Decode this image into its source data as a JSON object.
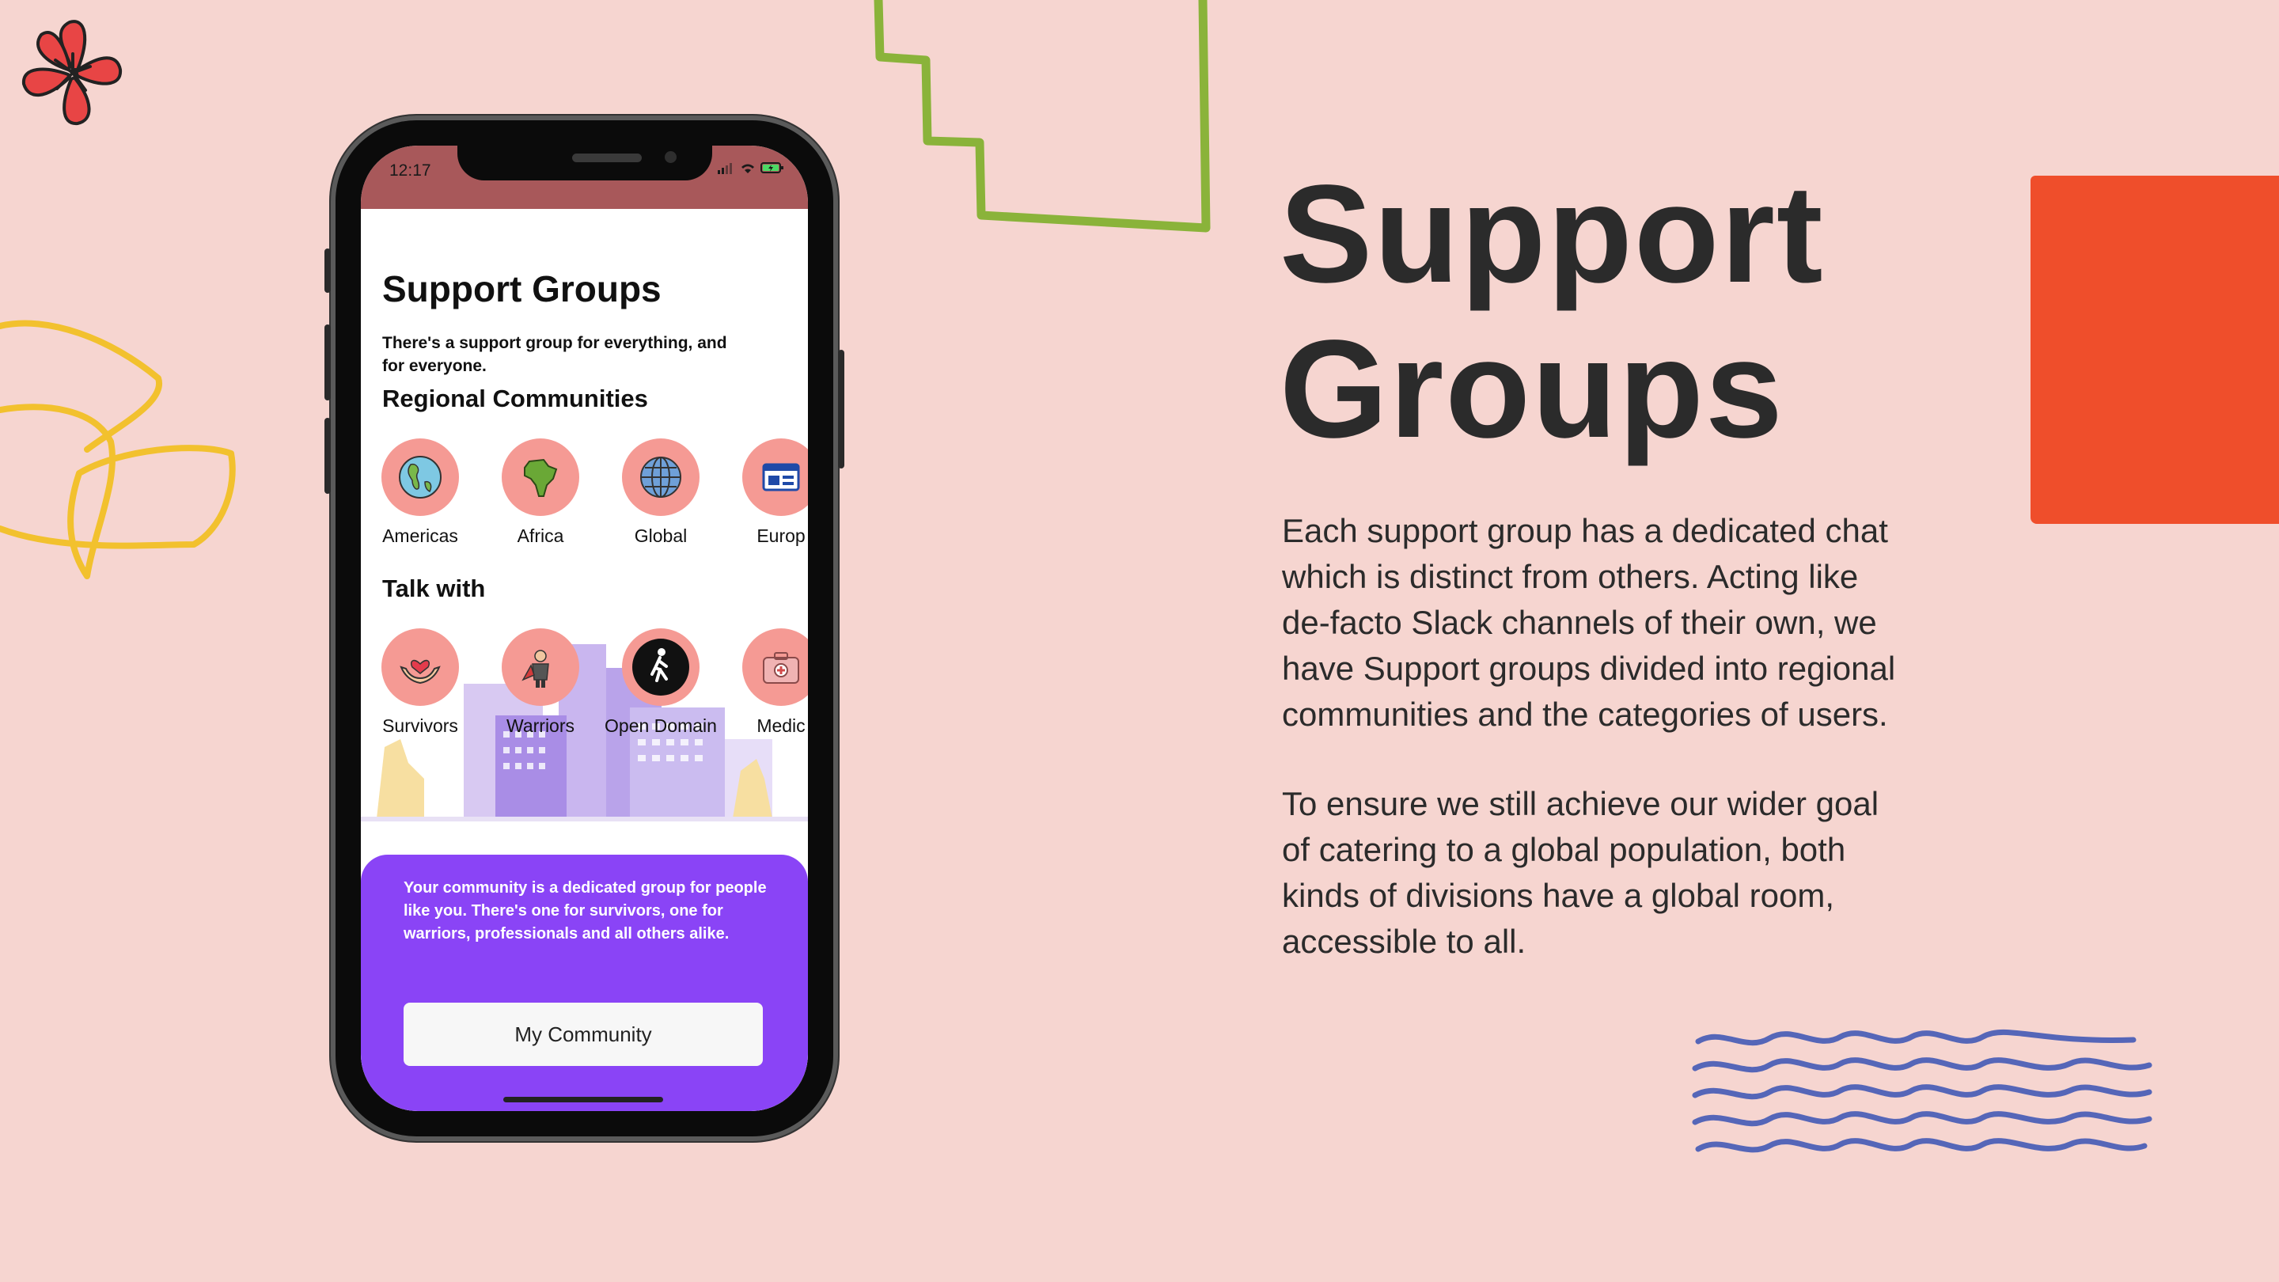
{
  "slide": {
    "heading_line1": "Support",
    "heading_line2": "Groups",
    "paragraph1": "Each support group has a dedicated chat which is distinct from others. Acting like de-facto Slack channels of their own, we have Support groups divided into regional communities and the categories of users.",
    "paragraph2": "To ensure we still achieve our wider goal of catering to a global population, both kinds of divisions have a global room, accessible to all."
  },
  "phone": {
    "status": {
      "time": "12:17"
    },
    "app": {
      "title": "Support Groups",
      "subtitle": "There's a support group for everything, and for everyone.",
      "regional": {
        "title": "Regional Communities",
        "items": [
          {
            "label": "Americas",
            "icon": "americas-globe-icon"
          },
          {
            "label": "Africa",
            "icon": "africa-map-icon"
          },
          {
            "label": "Global",
            "icon": "globe-icon"
          },
          {
            "label": "Europ",
            "icon": "europe-icon"
          }
        ]
      },
      "talk": {
        "title": "Talk with",
        "items": [
          {
            "label": "Survivors",
            "icon": "heart-hands-icon"
          },
          {
            "label": "Warriors",
            "icon": "warrior-icon"
          },
          {
            "label": "Open Domain",
            "icon": "walking-person-icon"
          },
          {
            "label": "Medic",
            "icon": "medical-kit-icon"
          }
        ]
      },
      "panel_text": "Your community is a dedicated group for people like you. There's one for survivors, one for warriors, professionals and all others alike.",
      "community_button": "My Community"
    }
  },
  "colors": {
    "background": "#f6d5d0",
    "accent_orange": "#ef4e2b",
    "accent_green": "#8ab33a",
    "accent_yellow": "#f2c12e",
    "accent_blue": "#5566b8",
    "flower_red": "#e84545",
    "panel_purple": "#8a44f6",
    "circle_pink": "#f59a94"
  }
}
